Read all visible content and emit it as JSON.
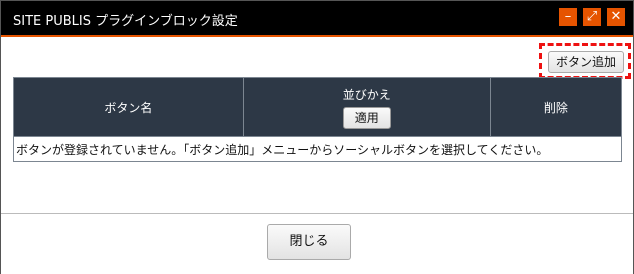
{
  "window": {
    "title": "SITE PUBLIS プラグインブロック設定",
    "minimize_glyph": "–",
    "maximize_glyph": "⤢",
    "close_glyph": "✕"
  },
  "toolbar": {
    "add_button_label": "ボタン追加"
  },
  "table": {
    "headers": {
      "button_name": "ボタン名",
      "sort": "並びかえ",
      "sort_apply": "適用",
      "delete": "削除"
    },
    "empty_message": "ボタンが登録されていません。「ボタン追加」メニューからソーシャルボタンを選択してください。"
  },
  "footer": {
    "close_label": "閉じる"
  },
  "colors": {
    "titlebar": "#000000",
    "accent": "#e65400",
    "table_header": "#2d3846",
    "highlight": "#ee1111"
  }
}
